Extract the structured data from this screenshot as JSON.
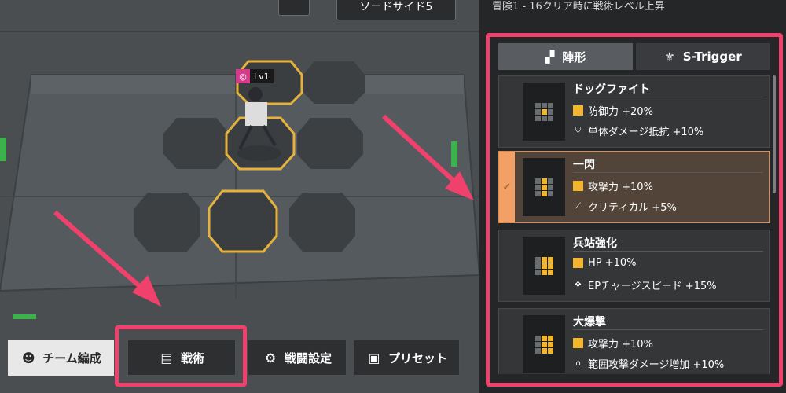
{
  "top": {
    "team_label": "ソードサイド5"
  },
  "unit": {
    "level": "Lv1"
  },
  "bottom_bar": {
    "team": "チーム編成",
    "tactics": "戦術",
    "battle_settings": "戦闘設定",
    "preset": "プリセット"
  },
  "panel": {
    "header": "冒険1 - 16クリア時に戦術レベル上昇",
    "tabs": [
      {
        "label": "陣形",
        "icon": "formation-icon",
        "active": true
      },
      {
        "label": "S-Trigger",
        "icon": "s-trigger-icon",
        "active": false
      }
    ],
    "formations": [
      {
        "name": "ドッグファイト",
        "stat1": "防御力 +20%",
        "stat2": "単体ダメージ抵抗 +10%",
        "selected": false
      },
      {
        "name": "一閃",
        "stat1": "攻撃力 +10%",
        "stat2": "クリティカル +5%",
        "selected": true
      },
      {
        "name": "兵站強化",
        "stat1": "HP +10%",
        "stat2": "EPチャージスピード +15%",
        "selected": false
      },
      {
        "name": "大爆撃",
        "stat1": "攻撃力 +10%",
        "stat2": "範囲攻撃ダメージ増加 +10%",
        "selected": false
      }
    ]
  },
  "colors": {
    "highlight": "#f0406c",
    "selected_accent": "#f3a066",
    "stat_yellow": "#f2b62e"
  }
}
